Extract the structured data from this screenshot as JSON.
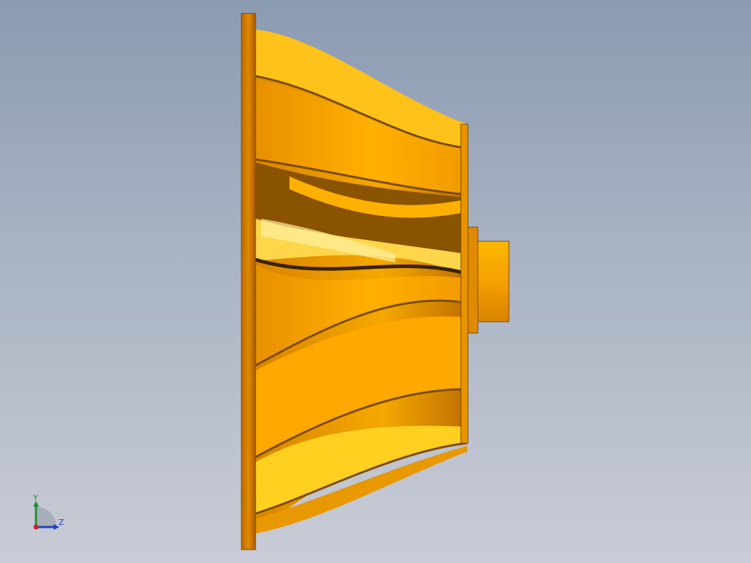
{
  "viewport": {
    "background_top": "#8b9bb2",
    "background_bottom": "#c9ccd6"
  },
  "model": {
    "part": "impeller",
    "view": "side",
    "color_base": "#f5a500",
    "color_highlight": "#ffd42a",
    "color_shadow": "#8a5300",
    "blade_count_visible": 8
  },
  "triad": {
    "y_label": "Y",
    "z_label": "Z",
    "y_color": "#1f8f2f",
    "z_color": "#1d3fbf",
    "x_color": "#d02020"
  }
}
